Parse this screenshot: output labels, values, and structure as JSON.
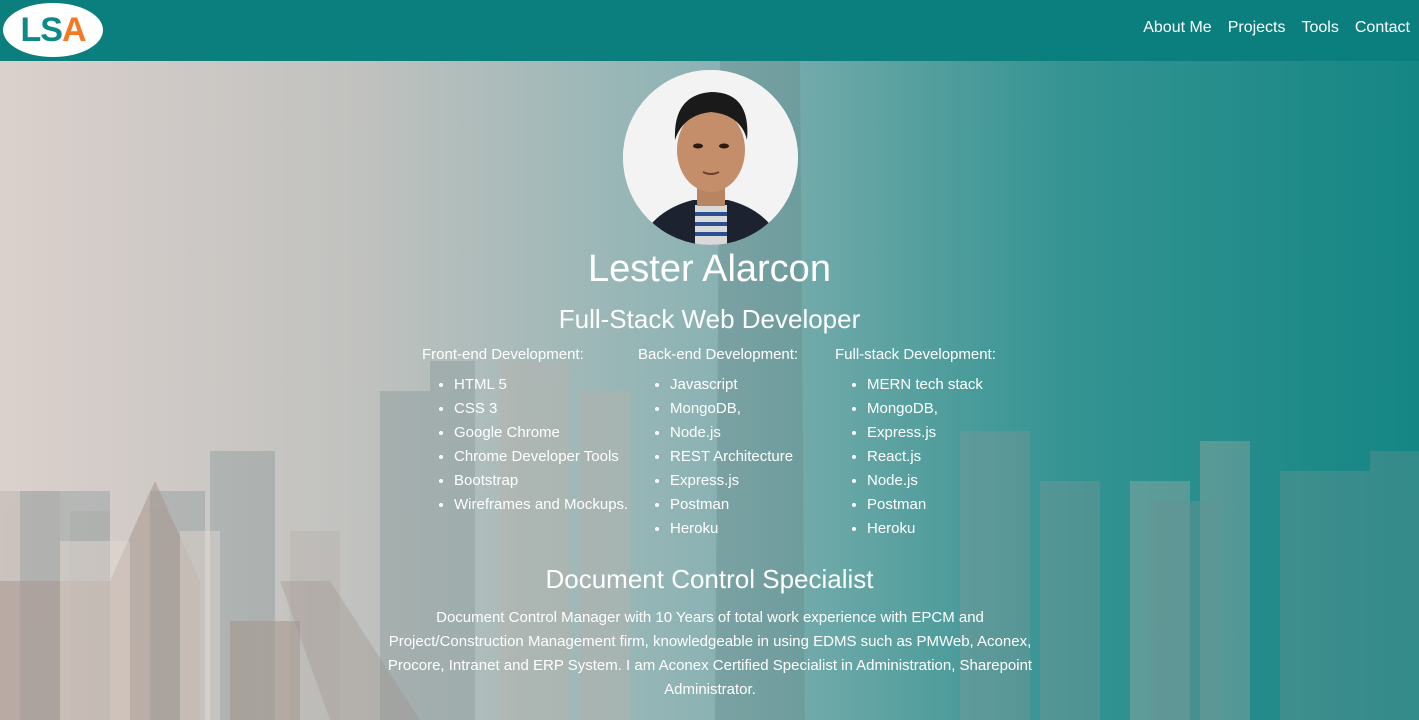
{
  "logo": {
    "letters": [
      "L",
      "S",
      "A"
    ]
  },
  "nav": {
    "items": [
      "About Me",
      "Projects",
      "Tools",
      "Contact"
    ]
  },
  "profile": {
    "name": "Lester Alarcon",
    "title": "Full-Stack Web Developer"
  },
  "skills": [
    {
      "heading": "Front-end Development:",
      "items": [
        "HTML 5",
        "CSS 3",
        "Google Chrome",
        "Chrome Developer Tools",
        "Bootstrap",
        "Wireframes and Mockups."
      ]
    },
    {
      "heading": "Back-end Development:",
      "items": [
        "Javascript",
        "MongoDB,",
        "Node.js",
        "REST Architecture",
        "Express.js",
        "Postman",
        "Heroku"
      ]
    },
    {
      "heading": "Full-stack Development:",
      "items": [
        "MERN tech stack",
        "MongoDB,",
        "Express.js",
        "React.js",
        "Node.js",
        "Postman",
        "Heroku"
      ]
    }
  ],
  "document_control": {
    "title": "Document Control Specialist",
    "description": "Document Control Manager with 10 Years of total work experience with EPCM and Project/Construction Management firm, knowledgeable in using EDMS such as PMWeb, Aconex, Procore, Intranet and ERP System. I am Aconex Certified Specialist in Administration, Sharepoint Administrator."
  },
  "colors": {
    "navbar": "#0a7f7e",
    "logo_teal": "#0d8a86",
    "logo_orange": "#f27a24",
    "text": "#ffffff"
  }
}
